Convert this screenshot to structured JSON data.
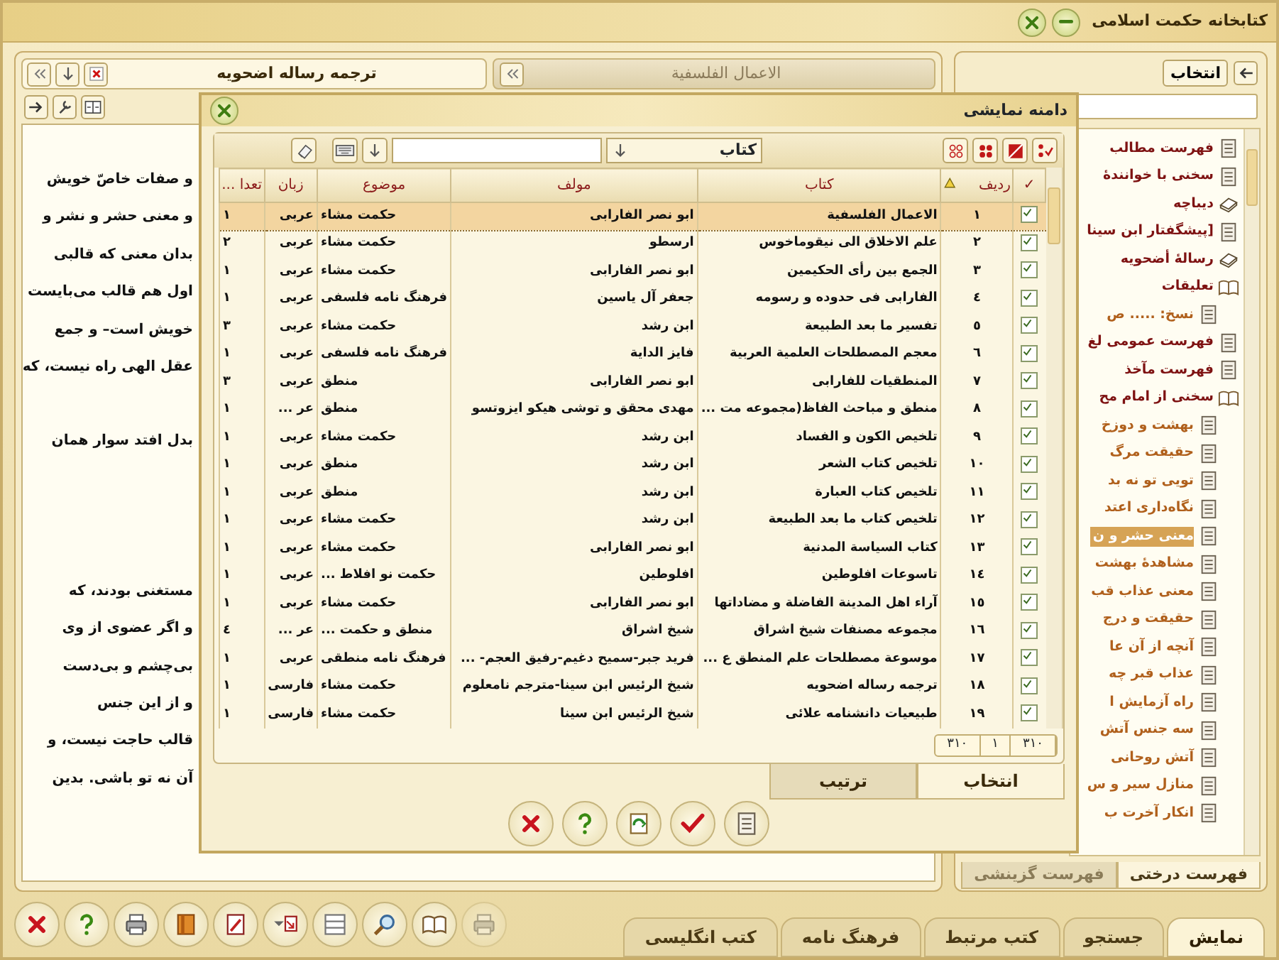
{
  "window": {
    "title": "کتابخانه حکمت اسلامی"
  },
  "reader": {
    "tabs": [
      {
        "label": "الاعمال الفلسفیة",
        "selected": false
      },
      {
        "label": "ترجمه رساله اضحویه",
        "selected": true
      }
    ],
    "paragraphs": [
      [
        "و صفات خاصّ خویش",
        "و معنی حشر و نشر و",
        "بدان معنی که قالبی",
        "اول هم قالب می‌بایست",
        "خویش است– و جمع",
        "عقل الهی راه نیست، که"
      ],
      [
        "بدل افتد سوار همان"
      ],
      [
        "مستغنی بودند، که",
        "و اگر عضوی از وی",
        "بی‌چشم و بی‌دست",
        "و از این جنس",
        "قالب حاجت نیست، و",
        "آن نه تو باشی. بدین"
      ]
    ]
  },
  "contents_panel": {
    "select_button": "انتخاب",
    "tree": [
      {
        "label": "فهرست مطالب",
        "kind": "page",
        "selected": false
      },
      {
        "label": "سخنی با خوانندهٔ",
        "kind": "page",
        "selected": false
      },
      {
        "label": "دیباچه",
        "kind": "book",
        "selected": false
      },
      {
        "label": "[پیشگفتار ابن سینا",
        "kind": "page",
        "selected": false
      },
      {
        "label": "رسالهٔ أضحویه",
        "kind": "book",
        "selected": false
      },
      {
        "label": "تعلیقات",
        "kind": "open-book",
        "selected": false,
        "children": [
          {
            "label": "نسخ: ..... ص",
            "kind": "page",
            "selected": false
          }
        ]
      },
      {
        "label": "فهرست عمومی لغ",
        "kind": "page",
        "selected": false
      },
      {
        "label": "فهرست مآخذ",
        "kind": "page",
        "selected": false
      },
      {
        "label": "سخنی از امام مح",
        "kind": "open-book",
        "selected": false,
        "children": [
          {
            "label": "بهشت و دوزخ",
            "kind": "page",
            "selected": false
          },
          {
            "label": "حقیقت مرگ",
            "kind": "page",
            "selected": false
          },
          {
            "label": "تویی تو نه بد",
            "kind": "page",
            "selected": false
          },
          {
            "label": "نگاه‌داری اعتد",
            "kind": "page",
            "selected": false
          },
          {
            "label": "معنی حشر و ن",
            "kind": "page",
            "selected": true
          },
          {
            "label": "مشاهدهٔ بهشت",
            "kind": "page",
            "selected": false
          },
          {
            "label": "معنی عذاب قب",
            "kind": "page",
            "selected": false
          },
          {
            "label": "حقیقت و درج",
            "kind": "page",
            "selected": false
          },
          {
            "label": "آنچه از آن عا",
            "kind": "page",
            "selected": false
          },
          {
            "label": "عذاب قبر چه",
            "kind": "page",
            "selected": false
          },
          {
            "label": "راه آزمایش ا",
            "kind": "page",
            "selected": false
          },
          {
            "label": "سه جنس آتش",
            "kind": "page",
            "selected": false
          },
          {
            "label": "آتش روحانی",
            "kind": "page",
            "selected": false
          },
          {
            "label": "منازل سیر و س",
            "kind": "page",
            "selected": false
          },
          {
            "label": "انکار آخرت ب",
            "kind": "page",
            "selected": false
          }
        ]
      }
    ],
    "tabs": [
      {
        "label": "فهرست درختی",
        "selected": true
      },
      {
        "label": "فهرست گزینشی",
        "selected": false
      }
    ]
  },
  "dialog": {
    "title": "دامنه نمایشی",
    "field_selector": "کتاب",
    "check_header": "✓",
    "columns": [
      {
        "label": "ردیف",
        "sorted": true
      },
      {
        "label": "کتاب",
        "sorted": false
      },
      {
        "label": "مولف",
        "sorted": false
      },
      {
        "label": "موضوع",
        "sorted": false
      },
      {
        "label": "زبان",
        "sorted": false
      },
      {
        "label": "تعدا ...",
        "sorted": false
      }
    ],
    "rows": [
      {
        "checked": true,
        "selected": true,
        "cells": [
          "١",
          "الاعمال الفلسفية",
          "ابو نصر الفارابی",
          "حکمت مشاء",
          "عربی",
          "١"
        ]
      },
      {
        "checked": true,
        "selected": false,
        "cells": [
          "٢",
          "علم الاخلاق الی نیقوماخوس",
          "ارسطو",
          "حکمت مشاء",
          "عربی",
          "٢"
        ]
      },
      {
        "checked": true,
        "selected": false,
        "cells": [
          "٣",
          "الجمع بین رأی الحکیمین",
          "ابو نصر الفارابی",
          "حکمت مشاء",
          "عربی",
          "١"
        ]
      },
      {
        "checked": true,
        "selected": false,
        "cells": [
          "٤",
          "الفارابی فی حدوده و رسومه",
          "جعفر آل یاسین",
          "فرهنگ نامه فلسفی",
          "عربی",
          "١"
        ]
      },
      {
        "checked": true,
        "selected": false,
        "cells": [
          "٥",
          "تفسیر ما بعد الطبیعة",
          "ابن رشد",
          "حکمت مشاء",
          "عربی",
          "٣"
        ]
      },
      {
        "checked": true,
        "selected": false,
        "cells": [
          "٦",
          "معجم المصطلحات العلمیة العربیة",
          "فایز الدایة",
          "فرهنگ نامه فلسفی",
          "عربی",
          "١"
        ]
      },
      {
        "checked": true,
        "selected": false,
        "cells": [
          "٧",
          "المنطقیات للفارابی",
          "ابو نصر الفارابی",
          "منطق",
          "عربی",
          "٣"
        ]
      },
      {
        "checked": true,
        "selected": false,
        "cells": [
          "٨",
          "منطق و مباحث الفاظ(مجموعه مت ...",
          "مهدی محقق و توشی هیکو ایزوتسو",
          "منطق",
          "عر ...",
          "١"
        ]
      },
      {
        "checked": true,
        "selected": false,
        "cells": [
          "٩",
          "تلخیص الکون و الفساد",
          "ابن رشد",
          "حکمت مشاء",
          "عربی",
          "١"
        ]
      },
      {
        "checked": true,
        "selected": false,
        "cells": [
          "١٠",
          "تلخیص کتاب الشعر",
          "ابن رشد",
          "منطق",
          "عربی",
          "١"
        ]
      },
      {
        "checked": true,
        "selected": false,
        "cells": [
          "١١",
          "تلخیص کتاب العبارة",
          "ابن رشد",
          "منطق",
          "عربی",
          "١"
        ]
      },
      {
        "checked": true,
        "selected": false,
        "cells": [
          "١٢",
          "تلخیص کتاب ما بعد الطبیعة",
          "ابن رشد",
          "حکمت مشاء",
          "عربی",
          "١"
        ]
      },
      {
        "checked": true,
        "selected": false,
        "cells": [
          "١٣",
          "کتاب السیاسة المدنیة",
          "ابو نصر الفارابی",
          "حکمت مشاء",
          "عربی",
          "١"
        ]
      },
      {
        "checked": true,
        "selected": false,
        "cells": [
          "١٤",
          "تاسوعات افلوطین",
          "افلوطین",
          "حکمت نو افلاط ...",
          "عربی",
          "١"
        ]
      },
      {
        "checked": true,
        "selected": false,
        "cells": [
          "١٥",
          "آراء اهل المدینة الفاضلة و مضاداتها",
          "ابو نصر الفارابی",
          "حکمت مشاء",
          "عربی",
          "١"
        ]
      },
      {
        "checked": true,
        "selected": false,
        "cells": [
          "١٦",
          "مجموعه مصنفات شیخ اشراق",
          "شیخ اشراق",
          "منطق و حکمت ...",
          "عر ...",
          "٤"
        ]
      },
      {
        "checked": true,
        "selected": false,
        "cells": [
          "١٧",
          "موسوعة مصطلحات علم المنطق ع ...",
          "فرید جبر-سمیح دغیم-رفیق العجم- ...",
          "فرهنگ نامه منطقی",
          "عربی",
          "١"
        ]
      },
      {
        "checked": true,
        "selected": false,
        "cells": [
          "١٨",
          "ترجمه رساله اضحویه",
          "شیخ الرئیس ابن سینا-مترجم نامعلوم",
          "حکمت مشاء",
          "فارسی",
          "١"
        ]
      },
      {
        "checked": true,
        "selected": false,
        "cells": [
          "١٩",
          "طبیعیات دانشنامه علائی",
          "شیخ الرئیس ابن سینا",
          "حکمت مشاء",
          "فارسی",
          "١"
        ]
      }
    ],
    "counter": [
      "٣١٠",
      "١",
      "٣١٠"
    ],
    "tabs": [
      {
        "label": "انتخاب",
        "selected": true
      },
      {
        "label": "ترتیب",
        "selected": false
      }
    ]
  },
  "toolbar": [
    {
      "kind": "close",
      "disabled": false
    },
    {
      "kind": "help",
      "disabled": false
    },
    {
      "kind": "print",
      "disabled": false
    },
    {
      "kind": "book",
      "disabled": false
    },
    {
      "kind": "edit",
      "disabled": false
    },
    {
      "kind": "jump",
      "disabled": false
    },
    {
      "kind": "list",
      "disabled": false
    },
    {
      "kind": "search",
      "disabled": false
    },
    {
      "kind": "open-book",
      "disabled": false
    },
    {
      "kind": "print",
      "disabled": true
    }
  ],
  "bottom_tabs": [
    {
      "label": "نمایش",
      "selected": true
    },
    {
      "label": "جستجو",
      "selected": false
    },
    {
      "label": "کتب مرتبط",
      "selected": false
    },
    {
      "label": "فرهنگ نامه",
      "selected": false
    },
    {
      "label": "کتب انگلیسی",
      "selected": false
    }
  ]
}
